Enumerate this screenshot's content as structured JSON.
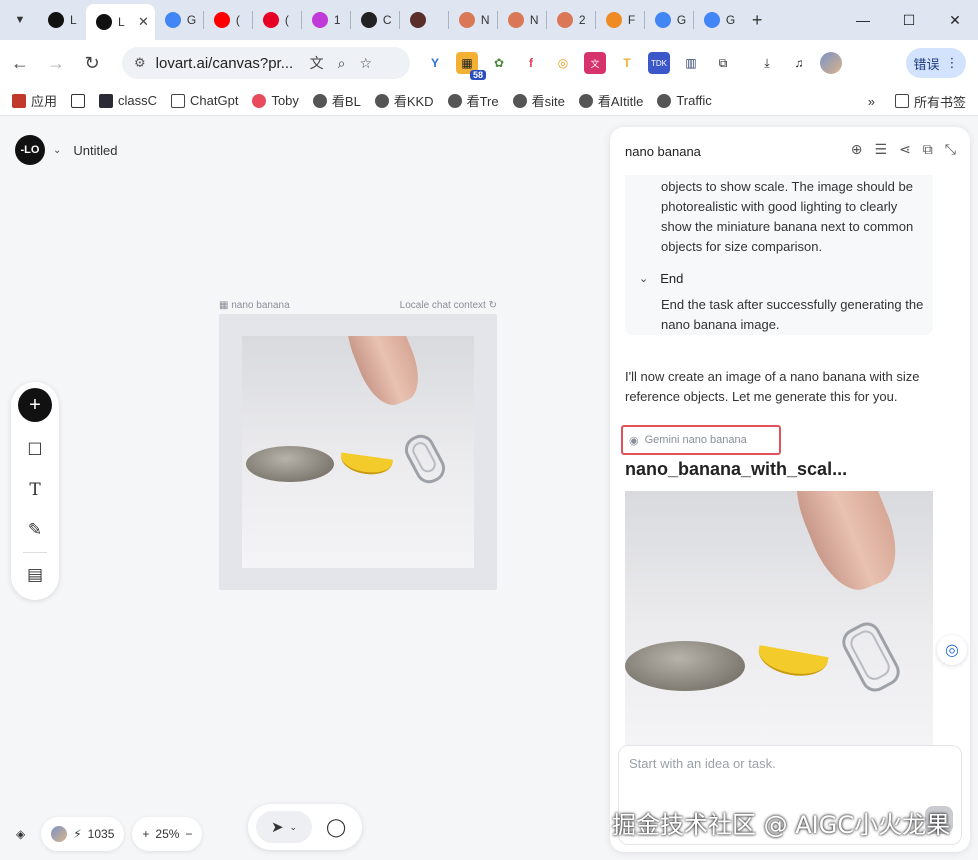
{
  "tabs": [
    {
      "title": "L",
      "icon": "lovart-icon",
      "color": "#111111",
      "active": false
    },
    {
      "title": "L",
      "icon": "lovart-icon",
      "color": "#111111",
      "active": true
    },
    {
      "title": "Gr",
      "icon": "google-icon",
      "color": "#4285f4",
      "active": false
    },
    {
      "title": "(",
      "icon": "youtube-icon",
      "color": "#ff0000",
      "active": false
    },
    {
      "title": "(",
      "icon": "pinterest-icon",
      "color": "#e60023",
      "active": false
    },
    {
      "title": "1",
      "icon": "butterfly-icon",
      "color": "#c03ad8",
      "active": false
    },
    {
      "title": "C",
      "icon": "circle-icon",
      "color": "#222222",
      "active": false
    },
    {
      "title": "",
      "icon": "image-icon",
      "color": "#5a2e2a",
      "active": false
    },
    {
      "title": "N",
      "icon": "claude-icon",
      "color": "#d97757",
      "active": false
    },
    {
      "title": "N",
      "icon": "claude-icon",
      "color": "#d97757",
      "active": false
    },
    {
      "title": "2",
      "icon": "claude-icon",
      "color": "#d97757",
      "active": false
    },
    {
      "title": "F",
      "icon": "a-icon",
      "color": "#f08a24",
      "active": false
    },
    {
      "title": "Gr",
      "icon": "google-icon",
      "color": "#4285f4",
      "active": false
    },
    {
      "title": "Gr",
      "icon": "google-icon",
      "color": "#4285f4",
      "active": false
    }
  ],
  "address": {
    "url": "lovart.ai/canvas?pr..."
  },
  "profile": {
    "error_label": "错误"
  },
  "extensions": {
    "badge_58": "58"
  },
  "bookmarks": {
    "apps": "应用",
    "items": [
      "classC",
      "ChatGpt",
      "Toby",
      "看BL",
      "看KKD",
      "看Tre",
      "看site",
      "看AItitle",
      "Traffic"
    ],
    "all_bookmarks": "所有书签"
  },
  "project": {
    "name": "Untitled",
    "logo_text": "-LO"
  },
  "frame": {
    "label": "nano banana",
    "action": "Locale chat context"
  },
  "bottom": {
    "credits": "1035",
    "zoom": "25%"
  },
  "chat": {
    "title": "nano banana",
    "step_text_1": "objects to show scale. The image should be photorealistic with good lighting to clearly show the miniature banana next to common objects for size comparison.",
    "step_end_title": "End",
    "step_end_text": "End the task after successfully generating the nano banana image.",
    "message": "I'll now create an image of a nano banana with size reference objects. Let me generate this for you.",
    "tool_label": "Gemini nano banana",
    "file_title": "nano_banana_with_scal...",
    "input_placeholder": "Start with an idea or task."
  },
  "watermark": "掘金技术社区 @ AIGC小火龙果",
  "colors": {
    "accent": "#111111",
    "highlight": "#e2525b",
    "profile_bg": "#d3e3fd"
  }
}
